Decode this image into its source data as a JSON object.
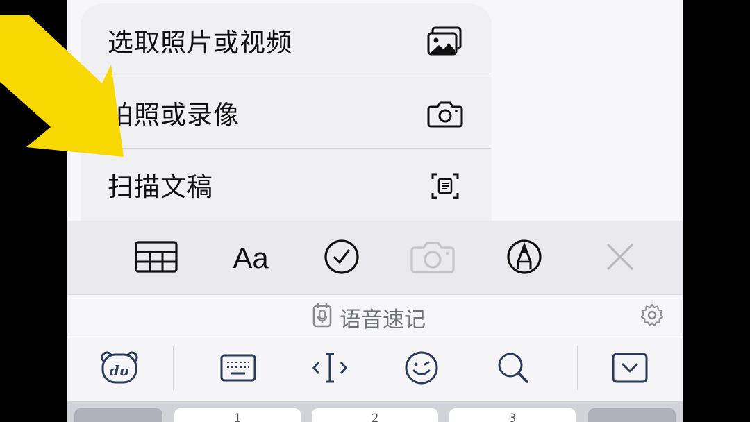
{
  "menu": {
    "items": [
      {
        "label": "选取照片或视频",
        "icon": "photo-library-icon"
      },
      {
        "label": "拍照或录像",
        "icon": "camera-icon"
      },
      {
        "label": "扫描文稿",
        "icon": "scan-document-icon"
      }
    ]
  },
  "toolbar": {
    "items": [
      "table-icon",
      "text-format-icon",
      "checklist-icon",
      "camera-icon",
      "markup-pen-icon",
      "close-icon"
    ],
    "text_format_label": "Aa"
  },
  "voice_bar": {
    "label": "语音速记"
  },
  "keyboard": {
    "number_keys": [
      "1",
      "2",
      "3"
    ]
  },
  "colors": {
    "arrow": "#f7d800",
    "menu_bg": "#f0f0f2",
    "toolbar_bg": "#e9e9ee",
    "disabled_icon": "#c3c3c8"
  }
}
